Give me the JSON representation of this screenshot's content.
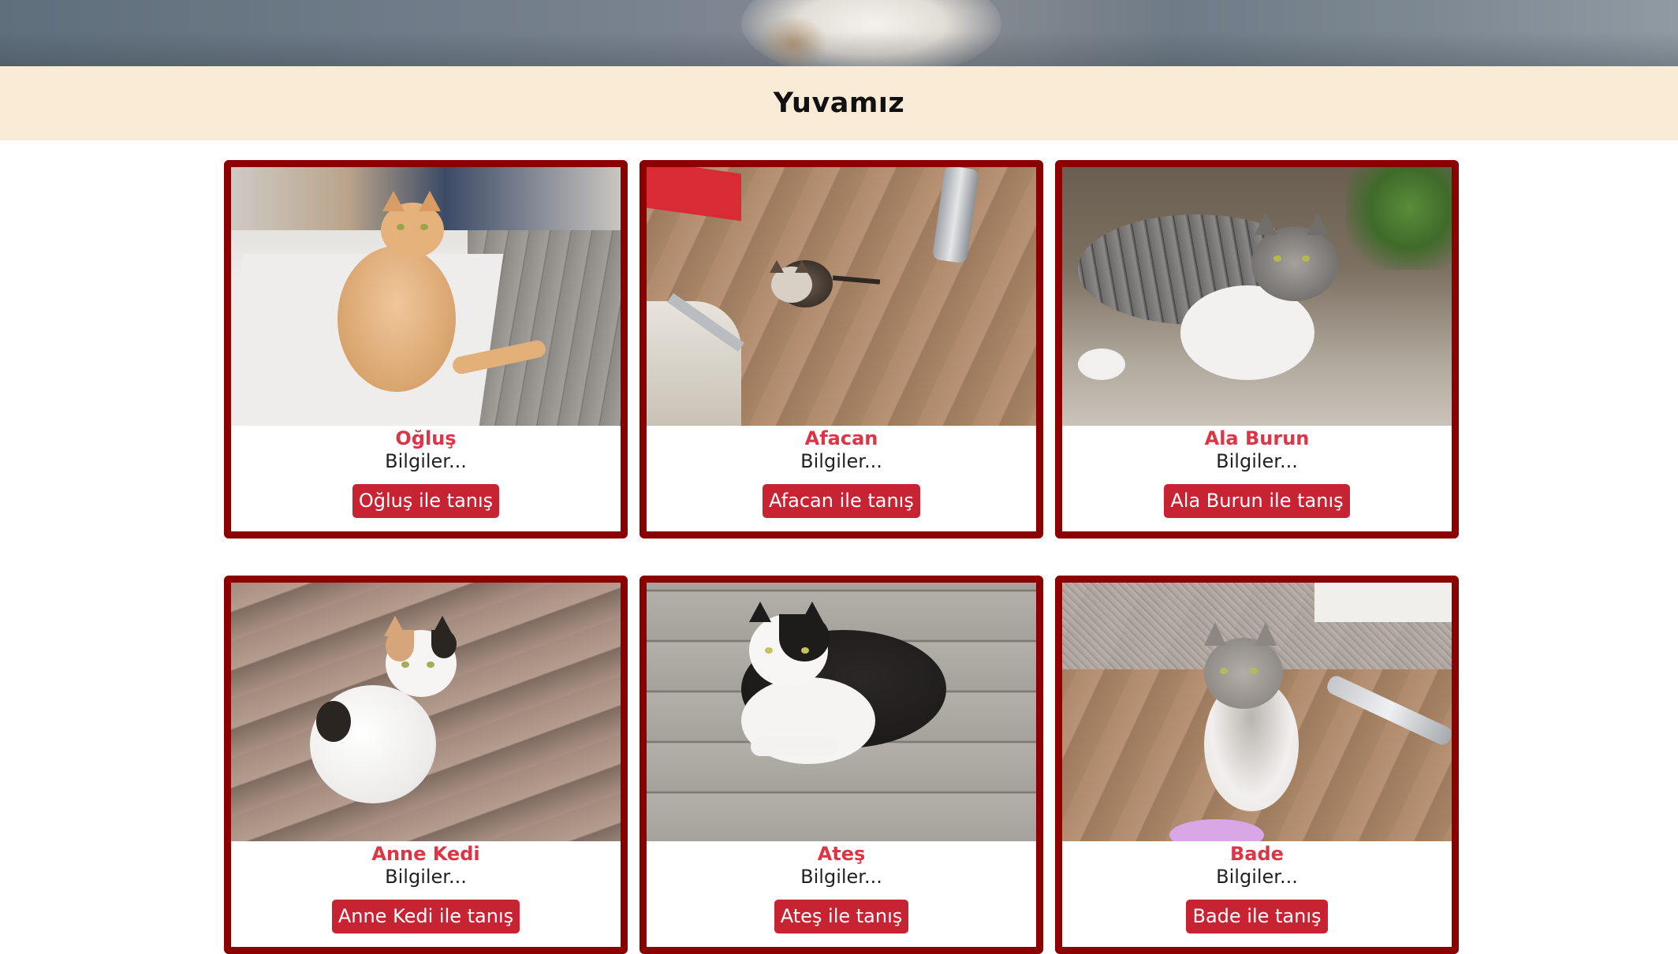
{
  "page": {
    "section_title": "Yuvamız"
  },
  "cats": [
    {
      "name": "Oğluş",
      "info": "Bilgiler...",
      "button": "Oğluş ile tanış"
    },
    {
      "name": "Afacan",
      "info": "Bilgiler...",
      "button": "Afacan ile tanış"
    },
    {
      "name": "Ala Burun",
      "info": "Bilgiler...",
      "button": "Ala Burun ile tanış"
    },
    {
      "name": "Anne Kedi",
      "info": "Bilgiler...",
      "button": "Anne Kedi ile tanış"
    },
    {
      "name": "Ateş",
      "info": "Bilgiler...",
      "button": "Ateş ile tanış"
    },
    {
      "name": "Bade",
      "info": "Bilgiler...",
      "button": "Bade ile tanış"
    }
  ],
  "colors": {
    "title_bar_bg": "#faebd7",
    "card_border": "#8b0000",
    "cat_name": "#dc3545",
    "button_bg": "#c82333"
  }
}
